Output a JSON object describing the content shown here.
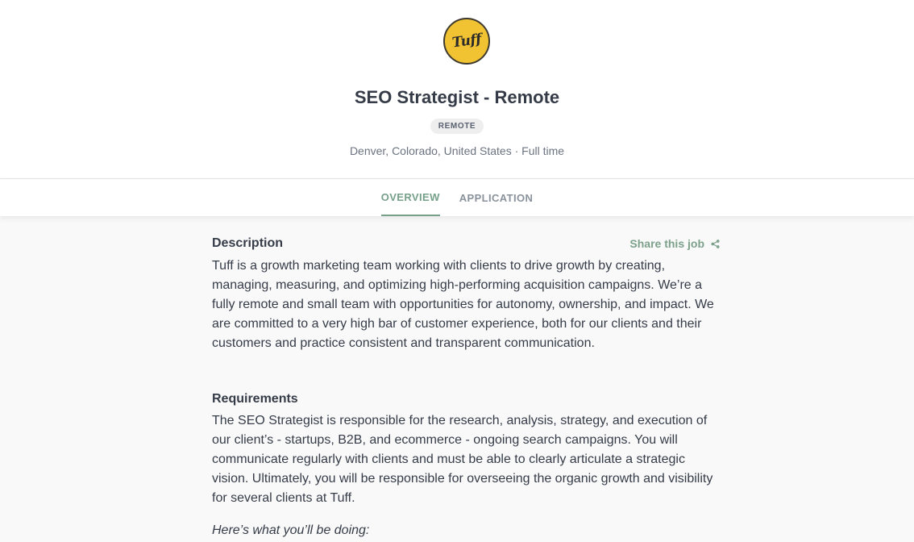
{
  "header": {
    "logo_text": "Tuff",
    "logo_color": "#f1c232",
    "title": "SEO Strategist - Remote",
    "badge": "REMOTE",
    "meta": "Denver, Colorado, United States · Full time"
  },
  "tabs": [
    {
      "label": "OVERVIEW",
      "active": true
    },
    {
      "label": "APPLICATION",
      "active": false
    }
  ],
  "accent_color": "#77a08a",
  "share": {
    "label": "Share this job",
    "icon": "share-icon"
  },
  "description": {
    "heading": "Description",
    "text": "Tuff is a growth marketing team working with clients to drive growth by creating, managing, measuring, and optimizing high-performing acquisition campaigns. We’re a fully remote and small team with opportunities for autonomy, ownership, and impact. We are committed to a very high bar of customer experience, both for our clients and their customers and practice consistent and transparent communication."
  },
  "requirements": {
    "heading": "Requirements",
    "text": "The SEO Strategist is responsible for the research, analysis, strategy, and execution of our client’s - startups, B2B, and ecommerce - ongoing search campaigns. You will communicate regularly with clients and must be able to clearly articulate a strategic vision. Ultimately, you will be responsible for overseeing the organic growth and visibility for several clients at Tuff.",
    "subheading": "Here’s what you’ll be doing:"
  }
}
